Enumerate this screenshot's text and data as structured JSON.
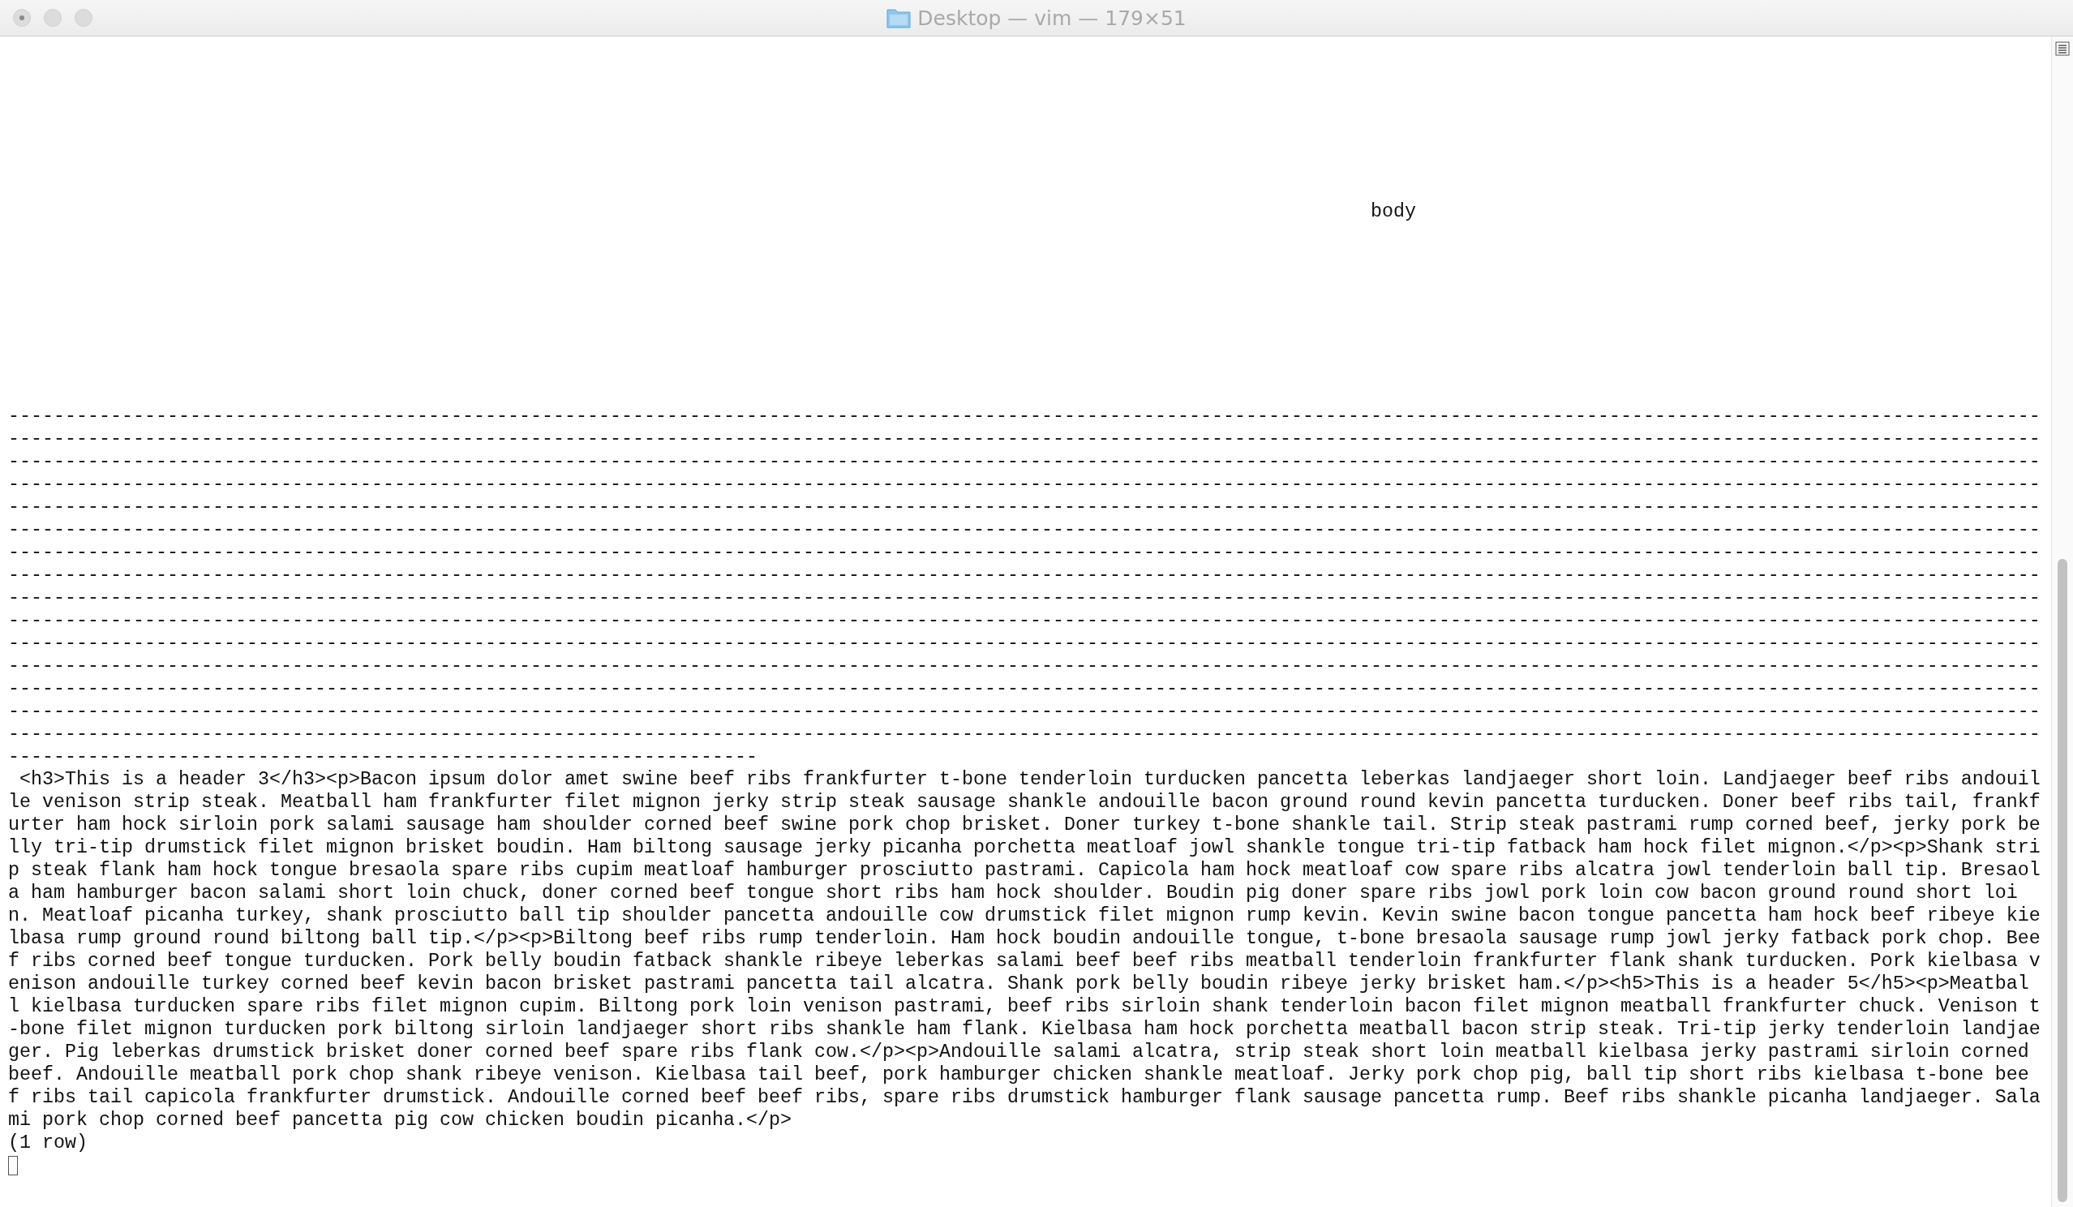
{
  "window": {
    "title": "Desktop — vim — 179×51"
  },
  "output": {
    "column_header": "body",
    "separator_rows": [
      "-----------------------------------------------------------------------------------------------------------------------------------------------------------------------------------",
      "-----------------------------------------------------------------------------------------------------------------------------------------------------------------------------------",
      "-----------------------------------------------------------------------------------------------------------------------------------------------------------------------------------",
      "-----------------------------------------------------------------------------------------------------------------------------------------------------------------------------------",
      "-----------------------------------------------------------------------------------------------------------------------------------------------------------------------------------",
      "-----------------------------------------------------------------------------------------------------------------------------------------------------------------------------------",
      "-----------------------------------------------------------------------------------------------------------------------------------------------------------------------------------",
      "-----------------------------------------------------------------------------------------------------------------------------------------------------------------------------------",
      "-----------------------------------------------------------------------------------------------------------------------------------------------------------------------------------",
      "-----------------------------------------------------------------------------------------------------------------------------------------------------------------------------------",
      "-----------------------------------------------------------------------------------------------------------------------------------------------------------------------------------",
      "-----------------------------------------------------------------------------------------------------------------------------------------------------------------------------------",
      "-----------------------------------------------------------------------------------------------------------------------------------------------------------------------------------",
      "-----------------------------------------------------------------------------------------------------------------------------------------------------------------------------------",
      "-----------------------------------------------------------------------------------------------------------------------------------------------------------------------------------",
      "------------------------------------------------------------------"
    ],
    "value": " <h3>This is a header 3</h3><p>Bacon ipsum dolor amet swine beef ribs frankfurter t-bone tenderloin turducken pancetta leberkas landjaeger short loin. Landjaeger beef ribs andouille venison strip steak. Meatball ham frankfurter filet mignon jerky strip steak sausage shankle andouille bacon ground round kevin pancetta turducken. Doner beef ribs tail, frankfurter ham hock sirloin pork salami sausage ham shoulder corned beef swine pork chop brisket. Doner turkey t-bone shankle tail. Strip steak pastrami rump corned beef, jerky pork belly tri-tip drumstick filet mignon brisket boudin. Ham biltong sausage jerky picanha porchetta meatloaf jowl shankle tongue tri-tip fatback ham hock filet mignon.</p><p>Shank strip steak flank ham hock tongue bresaola spare ribs cupim meatloaf hamburger prosciutto pastrami. Capicola ham hock meatloaf cow spare ribs alcatra jowl tenderloin ball tip. Bresaola ham hamburger bacon salami short loin chuck, doner corned beef tongue short ribs ham hock shoulder. Boudin pig doner spare ribs jowl pork loin cow bacon ground round short loin. Meatloaf picanha turkey, shank prosciutto ball tip shoulder pancetta andouille cow drumstick filet mignon rump kevin. Kevin swine bacon tongue pancetta ham hock beef ribeye kielbasa rump ground round biltong ball tip.</p><p>Biltong beef ribs rump tenderloin. Ham hock boudin andouille tongue, t-bone bresaola sausage rump jowl jerky fatback pork chop. Beef ribs corned beef tongue turducken. Pork belly boudin fatback shankle ribeye leberkas salami beef beef ribs meatball tenderloin frankfurter flank shank turducken. Pork kielbasa venison andouille turkey corned beef kevin bacon brisket pastrami pancetta tail alcatra. Shank pork belly boudin ribeye jerky brisket ham.</p><h5>This is a header 5</h5><p>Meatball kielbasa turducken spare ribs filet mignon cupim. Biltong pork loin venison pastrami, beef ribs sirloin shank tenderloin bacon filet mignon meatball frankfurter chuck. Venison t-bone filet mignon turducken pork biltong sirloin landjaeger short ribs shankle ham flank. Kielbasa ham hock porchetta meatball bacon strip steak. Tri-tip jerky tenderloin landjaeger. Pig leberkas drumstick brisket doner corned beef spare ribs flank cow.</p><p>Andouille salami alcatra, strip steak short loin meatball kielbasa jerky pastrami sirloin corned beef. Andouille meatball pork chop shank ribeye venison. Kielbasa tail beef, pork hamburger chicken shankle meatloaf. Jerky pork chop pig, ball tip short ribs kielbasa t-bone beef ribs tail capicola frankfurter drumstick. Andouille corned beef beef ribs, spare ribs drumstick hamburger flank sausage pancetta rump. Beef ribs shankle picanha landjaeger. Salami pork chop corned beef pancetta pig cow chicken boudin picanha.</p>",
    "row_count": "(1 row)"
  }
}
